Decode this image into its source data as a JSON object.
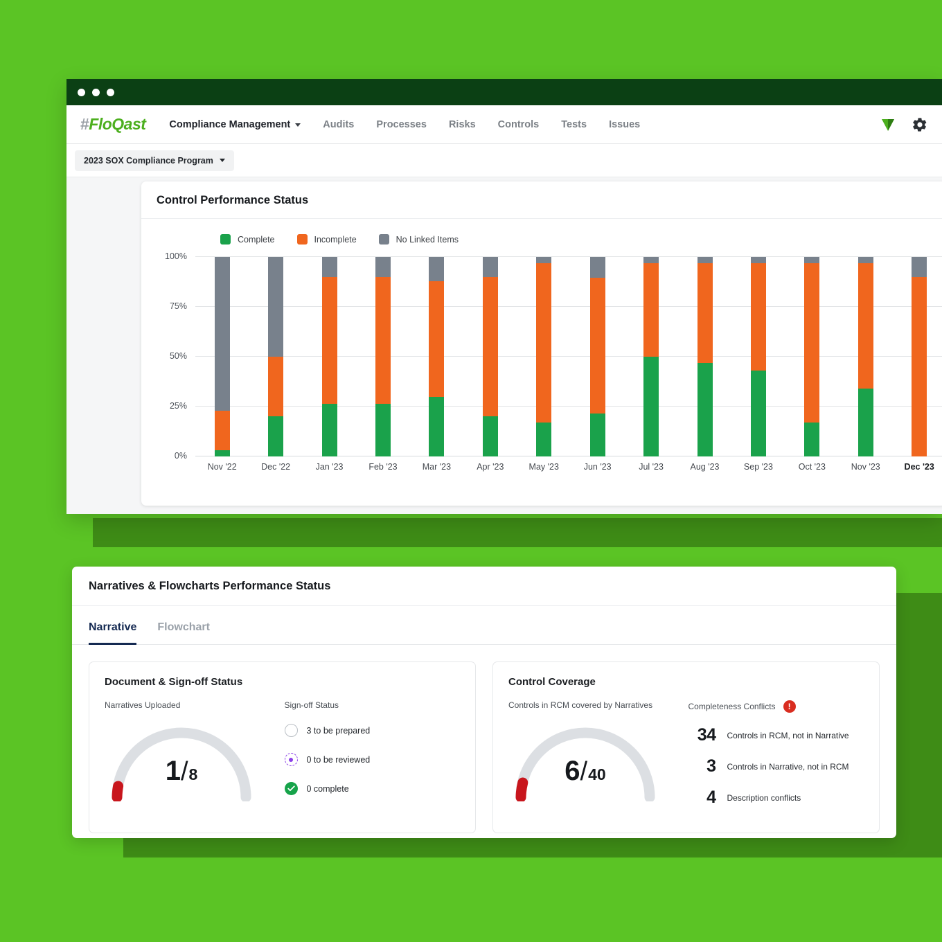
{
  "window": {
    "dots": 3
  },
  "nav": {
    "logo_hash": "#",
    "logo_name": "FloQast",
    "primary": "Compliance Management",
    "items": [
      {
        "label": "Audits"
      },
      {
        "label": "Processes"
      },
      {
        "label": "Risks"
      },
      {
        "label": "Controls"
      },
      {
        "label": "Tests"
      },
      {
        "label": "Issues"
      }
    ],
    "right_icons": [
      "flag-icon",
      "gear-icon"
    ]
  },
  "subbar": {
    "program": "2023 SOX Compliance Program"
  },
  "chart_card": {
    "title": "Control Performance Status"
  },
  "chart_data": {
    "type": "bar",
    "stacked": true,
    "title": "Control Performance Status",
    "xlabel": "",
    "ylabel": "",
    "ylim": [
      0,
      100
    ],
    "yticks": [
      "0%",
      "25%",
      "50%",
      "75%",
      "100%"
    ],
    "grid": true,
    "legend_position": "top-left",
    "categories": [
      "Nov '22",
      "Dec '22",
      "Jan '23",
      "Feb '23",
      "Mar '23",
      "Apr '23",
      "May '23",
      "Jun '23",
      "Jul '23",
      "Aug '23",
      "Sep '23",
      "Oct '23",
      "Nov '23",
      "Dec '23"
    ],
    "highlight_category": "Dec '23",
    "series": [
      {
        "name": "Complete",
        "color": "#1AA24B",
        "values": [
          3,
          20,
          26.5,
          26.5,
          30,
          20,
          17,
          21.5,
          50,
          47,
          43,
          17,
          34,
          0
        ]
      },
      {
        "name": "Incomplete",
        "color": "#F0661E",
        "values": [
          20,
          30,
          63.5,
          63.5,
          58,
          70,
          80,
          68,
          47,
          50,
          54,
          80,
          63,
          90
        ]
      },
      {
        "name": "No Linked Items",
        "color": "#78818C",
        "values": [
          77,
          50,
          10,
          10,
          12,
          10,
          3,
          10.5,
          3,
          3,
          3,
          3,
          3,
          10
        ]
      }
    ]
  },
  "bottom_panel": {
    "title": "Narratives & Flowcharts Performance Status",
    "tabs": [
      {
        "label": "Narrative",
        "active": true
      },
      {
        "label": "Flowchart",
        "active": false
      }
    ],
    "document_card": {
      "title": "Document & Sign-off Status",
      "gauge_label": "Narratives Uploaded",
      "gauge_value": "1",
      "gauge_separator": "/",
      "gauge_total": "8",
      "gauge_fill_color": "#C8161D",
      "gauge_track_color": "#DCDFE3",
      "signoff_label": "Sign-off Status",
      "signoff_items": [
        {
          "icon": "empty-circle-icon",
          "text": "3 to be prepared"
        },
        {
          "icon": "review-circle-icon",
          "text": "0 to be reviewed"
        },
        {
          "icon": "check-circle-icon",
          "text": "0 complete"
        }
      ]
    },
    "coverage_card": {
      "title": "Control Coverage",
      "gauge_label": "Controls in RCM covered by Narratives",
      "gauge_value": "6",
      "gauge_separator": "/",
      "gauge_total": "40",
      "conflicts_label": "Completeness Conflicts",
      "conflicts_icon": "alert-icon",
      "conflicts": [
        {
          "count": "34",
          "label": "Controls in RCM, not in Narrative"
        },
        {
          "count": "3",
          "label": "Controls in Narrative, not in RCM"
        },
        {
          "count": "4",
          "label": "Description conflicts"
        }
      ]
    }
  },
  "colors": {
    "background_green": "#5BC425",
    "deco_green": "#3E8C16",
    "titlebar_green": "#0B4014",
    "brand_green": "#4CAF1E",
    "accent_navy": "#152A52",
    "danger_red": "#D92D20"
  }
}
